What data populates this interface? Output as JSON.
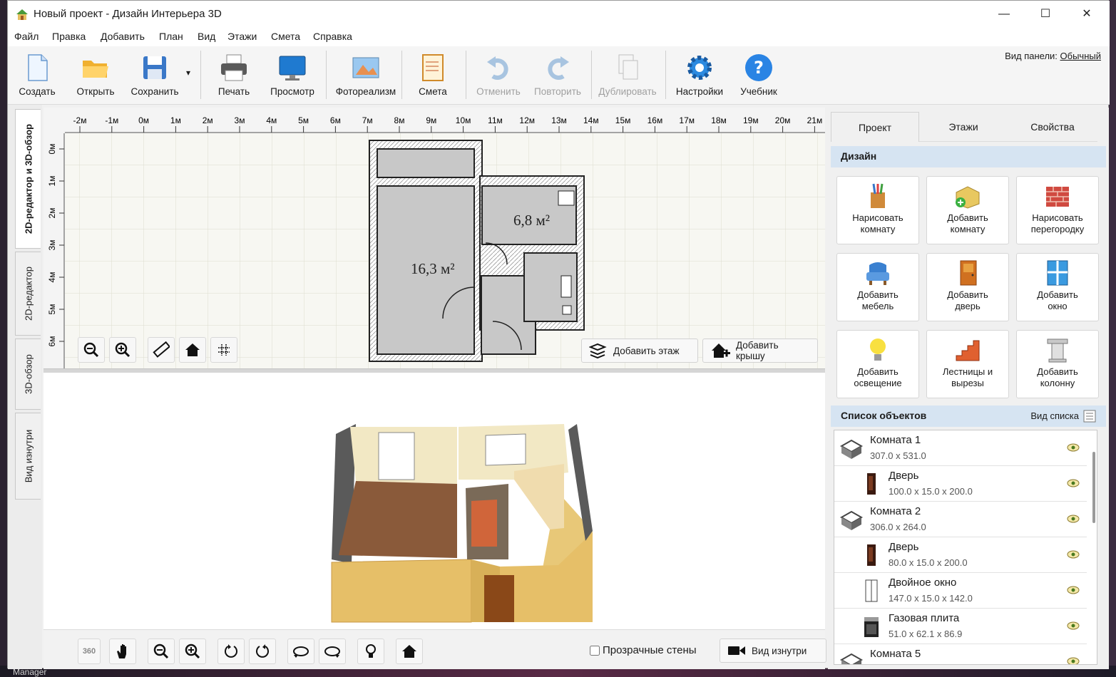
{
  "window": {
    "title": "Новый проект - Дизайн Интерьера 3D",
    "minimize": "—",
    "maximize": "☐",
    "close": "✕"
  },
  "menu": [
    "Файл",
    "Правка",
    "Добавить",
    "План",
    "Вид",
    "Этажи",
    "Смета",
    "Справка"
  ],
  "toolbar": {
    "buttons": [
      {
        "label": "Создать",
        "icon": "new-file-icon"
      },
      {
        "label": "Открыть",
        "icon": "open-folder-icon"
      },
      {
        "label": "Сохранить",
        "icon": "save-icon"
      },
      {
        "label": "Печать",
        "icon": "printer-icon"
      },
      {
        "label": "Просмотр",
        "icon": "monitor-icon"
      },
      {
        "label": "Фотореализм",
        "icon": "photo-icon"
      },
      {
        "label": "Смета",
        "icon": "notepad-icon"
      },
      {
        "label": "Отменить",
        "icon": "undo-icon",
        "disabled": true
      },
      {
        "label": "Повторить",
        "icon": "redo-icon",
        "disabled": true
      },
      {
        "label": "Дублировать",
        "icon": "duplicate-icon",
        "disabled": true
      },
      {
        "label": "Настройки",
        "icon": "gear-icon"
      },
      {
        "label": "Учебник",
        "icon": "help-icon"
      }
    ],
    "save_dropdown": "▾",
    "panel_view_label": "Вид панели:",
    "panel_view_value": "Обычный"
  },
  "vertical_tabs": [
    "2D-редактор и 3D-обзор",
    "2D-редактор",
    "3D-обзор",
    "Вид изнутри"
  ],
  "plan": {
    "ruler_x": [
      "-2м",
      "-1м",
      "0м",
      "1м",
      "2м",
      "3м",
      "4м",
      "5м",
      "6м",
      "7м",
      "8м",
      "9м",
      "10м",
      "11м",
      "12м",
      "13м",
      "14м",
      "15м",
      "16м",
      "17м",
      "18м",
      "19м",
      "20м",
      "21м"
    ],
    "ruler_y": [
      "0м",
      "1м",
      "2м",
      "3м",
      "4м",
      "5м",
      "6м"
    ],
    "rooms": [
      {
        "area": "16,3 м²"
      },
      {
        "area": "6,8 м²"
      }
    ],
    "add_floor": "Добавить этаж",
    "add_roof": "Добавить крышу"
  },
  "view3d": {
    "transparent_walls": "Прозрачные стены",
    "inside_view": "Вид изнутри",
    "badge_360": "360"
  },
  "right_panel": {
    "tabs": [
      "Проект",
      "Этажи",
      "Свойства"
    ],
    "design_header": "Дизайн",
    "design_buttons": [
      {
        "label1": "Нарисовать",
        "label2": "комнату",
        "icon": "pencils-icon"
      },
      {
        "label1": "Добавить",
        "label2": "комнату",
        "icon": "add-room-icon"
      },
      {
        "label1": "Нарисовать",
        "label2": "перегородку",
        "icon": "brick-wall-icon"
      },
      {
        "label1": "Добавить",
        "label2": "мебель",
        "icon": "armchair-icon"
      },
      {
        "label1": "Добавить",
        "label2": "дверь",
        "icon": "door-icon"
      },
      {
        "label1": "Добавить",
        "label2": "окно",
        "icon": "window-icon"
      },
      {
        "label1": "Добавить",
        "label2": "освещение",
        "icon": "lightbulb-icon"
      },
      {
        "label1": "Лестницы и",
        "label2": "вырезы",
        "icon": "stairs-icon"
      },
      {
        "label1": "Добавить",
        "label2": "колонну",
        "icon": "column-icon"
      }
    ],
    "objects_header": "Список объектов",
    "list_view": "Вид списка",
    "objects": [
      {
        "name": "Комната 1",
        "dims": "307.0 x 531.0",
        "type": "room",
        "indent": false
      },
      {
        "name": "Дверь",
        "dims": "100.0 x 15.0 x 200.0",
        "type": "door",
        "indent": true
      },
      {
        "name": "Комната 2",
        "dims": "306.0 x 264.0",
        "type": "room",
        "indent": false
      },
      {
        "name": "Дверь",
        "dims": "80.0 x 15.0 x 200.0",
        "type": "door",
        "indent": true
      },
      {
        "name": "Двойное окно",
        "dims": "147.0 x 15.0 x 142.0",
        "type": "window",
        "indent": true
      },
      {
        "name": "Газовая плита",
        "dims": "51.0 x 62.1 x 86.9",
        "type": "stove",
        "indent": true
      },
      {
        "name": "Комната 5",
        "dims": "",
        "type": "room",
        "indent": false
      }
    ]
  },
  "taskbar": {
    "label": "Manager"
  }
}
